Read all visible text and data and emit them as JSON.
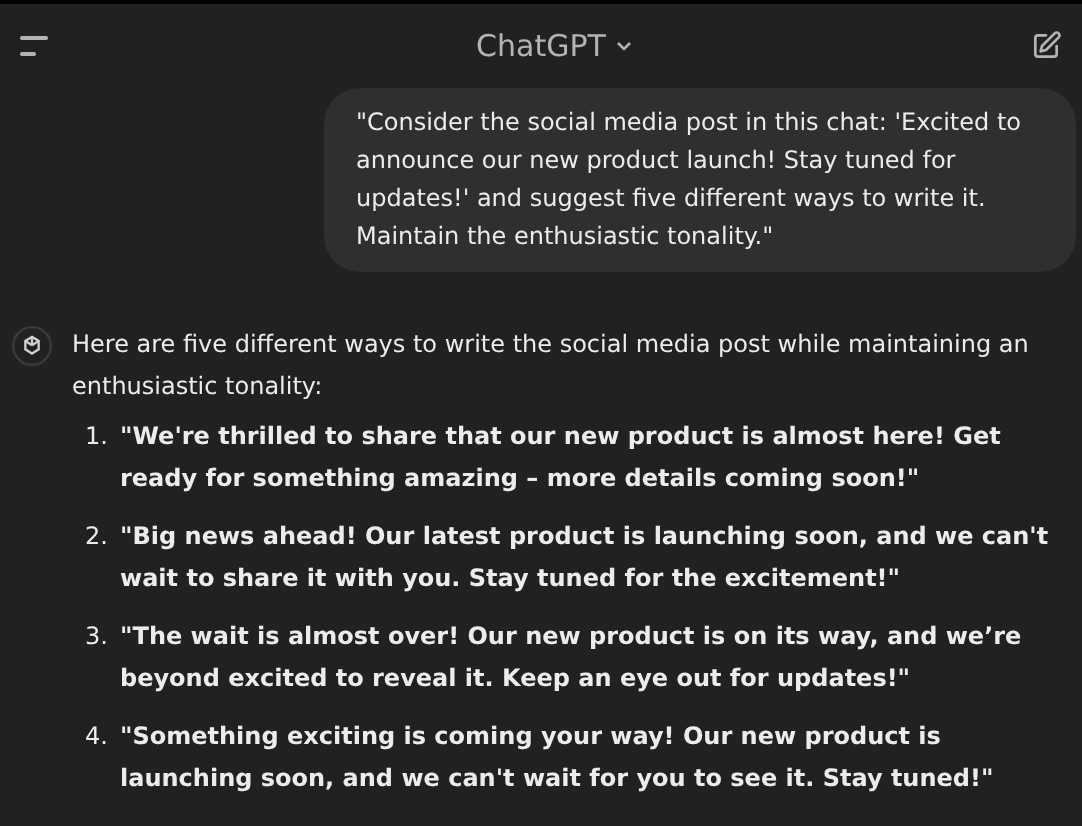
{
  "header": {
    "title": "ChatGPT"
  },
  "user_message": "\"Consider the social media post in this chat: 'Excited to announce our new product launch! Stay tuned for updates!' and suggest five different ways to write it. Maintain the enthusiastic tonality.\"",
  "assistant": {
    "intro": "Here are five different ways to write the social media post while maintaining an enthusiastic tonality:",
    "items": [
      {
        "number": "1.",
        "text": "\"We're thrilled to share that our new product is almost here! Get ready for something amazing – more details coming soon!\""
      },
      {
        "number": "2.",
        "text": "\"Big news ahead! Our latest product is launching soon, and we can't wait to share it with you. Stay tuned for the excitement!\""
      },
      {
        "number": "3.",
        "text": "\"The wait is almost over! Our new product is on its way, and we’re beyond excited to reveal it. Keep an eye out for updates!\""
      },
      {
        "number": "4.",
        "text": "\"Something exciting is coming your way! Our new product is launching soon, and we can't wait for you to see it. Stay tuned!\""
      }
    ]
  }
}
